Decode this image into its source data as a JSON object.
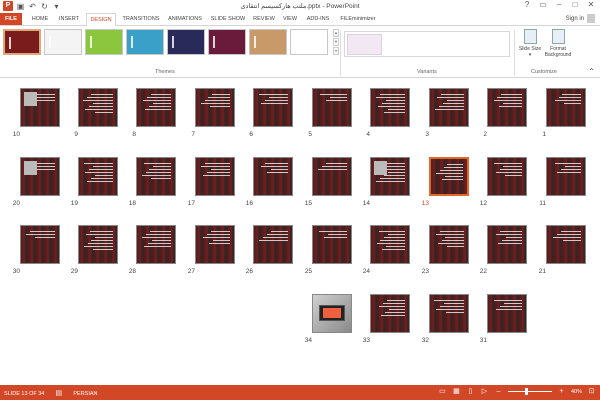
{
  "title": {
    "doc": "ملتب هارکسیسم انتقادی.pptx - PowerPoint"
  },
  "qat": {
    "save_icon": "save-icon",
    "undo_icon": "undo-icon",
    "redo_icon": "redo-icon"
  },
  "window": {
    "help": "?",
    "restore": "▭",
    "minimize": "–",
    "maximize": "□",
    "close": "✕"
  },
  "tabs": [
    {
      "label": "FILE"
    },
    {
      "label": "HOME"
    },
    {
      "label": "INSERT"
    },
    {
      "label": "DESIGN"
    },
    {
      "label": "TRANSITIONS"
    },
    {
      "label": "ANIMATIONS"
    },
    {
      "label": "SLIDE SHOW"
    },
    {
      "label": "REVIEW"
    },
    {
      "label": "VIEW"
    },
    {
      "label": "ADD-INS"
    },
    {
      "label": "FILEminimizer"
    }
  ],
  "signin": "Sign in",
  "ribbon": {
    "themes_label": "Themes",
    "variants_label": "Variants",
    "customize_label": "Customize",
    "slide_size": "Slide Size ▾",
    "format_background": "Format Background"
  },
  "themes": [
    {
      "name": "theme-1",
      "color": "#7a1c1c"
    },
    {
      "name": "theme-2",
      "color": "#f4f4f4"
    },
    {
      "name": "theme-3",
      "color": "#8cc63f"
    },
    {
      "name": "theme-4",
      "color": "#3aa0c8"
    },
    {
      "name": "theme-5",
      "color": "#2a2a5a"
    },
    {
      "name": "theme-6",
      "color": "#6a1a3a"
    },
    {
      "name": "theme-7",
      "color": "#c89a6a"
    },
    {
      "name": "theme-8",
      "color": "#ffffff"
    }
  ],
  "slides": {
    "selected": 13,
    "numbers": [
      "10",
      "9",
      "8",
      "7",
      "6",
      "5",
      "4",
      "3",
      "2",
      "1",
      "20",
      "19",
      "18",
      "17",
      "16",
      "15",
      "14",
      "13",
      "12",
      "11",
      "30",
      "29",
      "28",
      "27",
      "26",
      "25",
      "24",
      "23",
      "22",
      "21",
      "34",
      "33",
      "32",
      "31"
    ]
  },
  "status": {
    "slide_info": "SLIDE 13 OF 34",
    "language": "PERSIAN",
    "zoom": "40%",
    "zoom_fraction": 0.4
  },
  "colors": {
    "accent": "#d24726",
    "selection": "#e06a2c"
  }
}
